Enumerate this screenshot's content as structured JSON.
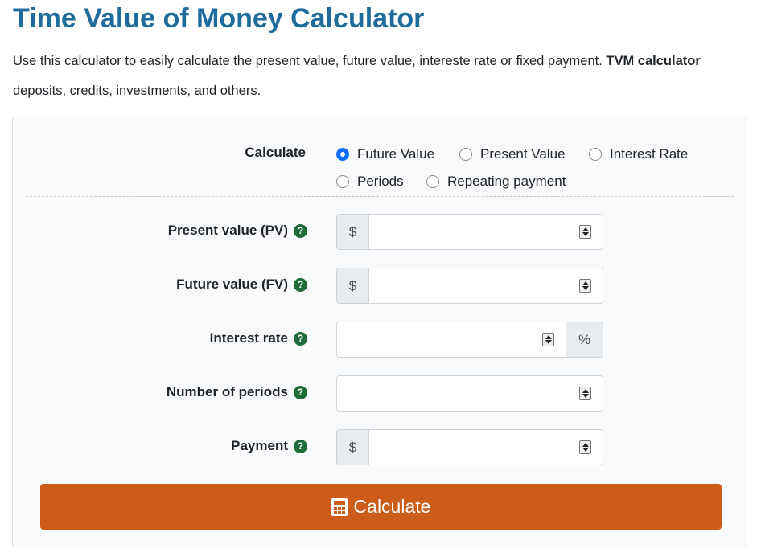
{
  "header": {
    "title": "Time Value of Money Calculator",
    "intro_line1_text": "Use this calculator to easily calculate the present value, future value, intereste rate or fixed payment. ",
    "intro_line1_bold": "TVM calculator",
    "intro_line2_text": "deposits, credits, investments, and others."
  },
  "calculate_mode": {
    "label": "Calculate",
    "options": [
      {
        "label": "Future Value",
        "checked": true
      },
      {
        "label": "Present Value",
        "checked": false
      },
      {
        "label": "Interest Rate",
        "checked": false
      },
      {
        "label": "Periods",
        "checked": false
      },
      {
        "label": "Repeating payment",
        "checked": false
      }
    ]
  },
  "fields": {
    "present_value": {
      "label": "Present value (PV)",
      "prefix": "$",
      "value": ""
    },
    "future_value": {
      "label": "Future value (FV)",
      "prefix": "$",
      "value": ""
    },
    "interest_rate": {
      "label": "Interest rate",
      "suffix": "%",
      "value": ""
    },
    "number_of_periods": {
      "label": "Number of periods",
      "value": ""
    },
    "payment": {
      "label": "Payment",
      "prefix": "$",
      "value": ""
    }
  },
  "help_icon_glyph": "?",
  "button": {
    "label": "Calculate",
    "icon": "calculator-icon",
    "color": "#cb5c19"
  },
  "colors": {
    "title": "#1f6b9c",
    "help_icon": "#1f6b39",
    "radio_checked": "#0d6efd"
  }
}
